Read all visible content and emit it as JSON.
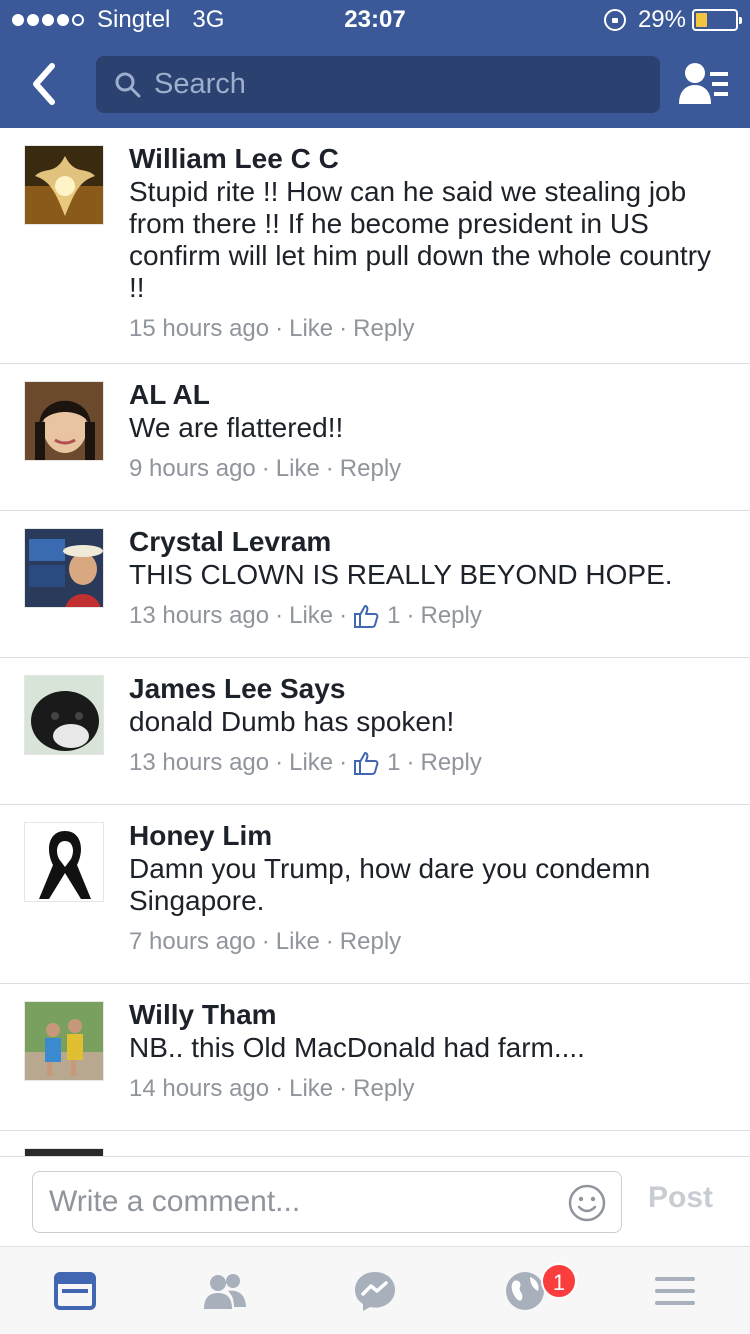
{
  "status_bar": {
    "carrier": "Singtel",
    "network": "3G",
    "time": "23:07",
    "battery": "29%",
    "battery_level": 0.29,
    "icons": [
      "signal-dots-icon",
      "rotation-lock-icon",
      "battery-icon"
    ]
  },
  "nav": {
    "back_icon": "chevron-left-icon",
    "search_placeholder": "Search",
    "search_icon": "search-icon",
    "friends_icon": "friends-list-icon"
  },
  "colors": {
    "brand": "#3b5998",
    "search_bg": "#2b4170",
    "meta_text": "#90949c",
    "like_blue": "#4267b2",
    "badge_red": "#fa3e3e",
    "battery_yellow": "#f5c542"
  },
  "comments": [
    {
      "author": "William Lee C C",
      "text": "Stupid rite !! How can he said we stealing job from there !! If he become president in US confirm will let him pull down the whole country !!",
      "time": "15 hours ago",
      "like": "Like",
      "reply": "Reply",
      "likes": null
    },
    {
      "author": "AL AL",
      "text": "We are flattered!!",
      "time": "9 hours ago",
      "like": "Like",
      "reply": "Reply",
      "likes": null
    },
    {
      "author": "Crystal Levram",
      "text": "THIS CLOWN IS REALLY BEYOND HOPE.",
      "time": "13 hours ago",
      "like": "Like",
      "reply": "Reply",
      "likes": "1"
    },
    {
      "author": "James Lee Says",
      "text": "donald Dumb has spoken!",
      "time": "13 hours ago",
      "like": "Like",
      "reply": "Reply",
      "likes": "1"
    },
    {
      "author": "Honey Lim",
      "text": "Damn you Trump, how dare you condemn Singapore.",
      "time": "7 hours ago",
      "like": "Like",
      "reply": "Reply",
      "likes": null
    },
    {
      "author": "Willy Tham",
      "text": "NB.. this Old MacDonald had farm....",
      "time": "14 hours ago",
      "like": "Like",
      "reply": "Reply",
      "likes": null
    }
  ],
  "composer": {
    "placeholder": "Write a comment...",
    "post_label": "Post",
    "emoji_icon": "smiley-icon"
  },
  "tab_bar": {
    "tabs": [
      "news-feed-icon",
      "friend-requests-icon",
      "messenger-icon",
      "notifications-globe-icon",
      "menu-icon"
    ],
    "notification_badge": "1"
  }
}
